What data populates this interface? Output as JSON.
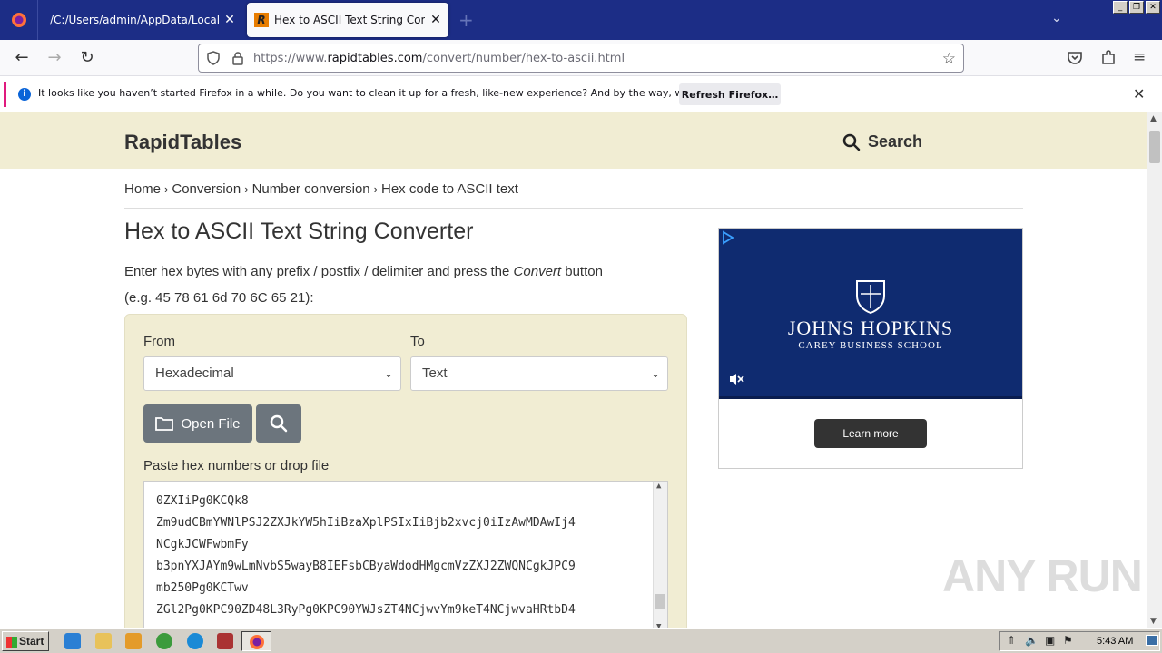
{
  "browser": {
    "tabs": [
      {
        "label": "/C:/Users/admin/AppData/Local/Temp/"
      },
      {
        "label": "Hex to ASCII Text String Converter",
        "active": true
      }
    ],
    "url_prefix": "https://www.",
    "url_domain": "rapidtables.com",
    "url_path": "/convert/number/hex-to-ascii.html"
  },
  "notification": {
    "text": "It looks like you haven’t started Firefox in a while. Do you want to clean it up for a fresh, like-new experience? And by the way, welcome back!",
    "button": "Refresh Firefox…"
  },
  "site": {
    "logo": "RapidTables",
    "search_label": "Search"
  },
  "breadcrumb": [
    "Home",
    "Conversion",
    "Number conversion",
    "Hex code to ASCII text"
  ],
  "page": {
    "title": "Hex to ASCII Text String Converter",
    "intro_a": "Enter hex bytes with any prefix / postfix / delimiter and press the ",
    "intro_em": "Convert",
    "intro_b": " button",
    "example": "(e.g. 45 78 61 6d 70 6C 65 21):"
  },
  "form": {
    "from_label": "From",
    "from_value": "Hexadecimal",
    "to_label": "To",
    "to_value": "Text",
    "open_file": "Open File",
    "paste_label": "Paste hex numbers or drop file",
    "hex_lines": [
      "0ZXIiPg0KCQk8",
      "Zm9udCBmYWNlPSJ2ZXJkYW5hIiBzaXplPSIxIiBjb2xvcj0iIzAwMDAwIj4",
      "NCgkJCWFwbmFy",
      "b3pnYXJAYm9wLmNvbS5wayB8IEFsbCByaWdodHMgcmVzZXJ2ZWQNCgkJPC9",
      "mb250Pg0KCTwv",
      "ZGl2Pg0KPC90ZD48L3RyPg0KPC90YWJsZT4NCjwvYm9keT4NCjwvaHRtbD4"
    ]
  },
  "ad": {
    "brand": "JOHNS HOPKINS",
    "sub": "CAREY BUSINESS SCHOOL",
    "button": "Learn more"
  },
  "watermark": "ANY RUN",
  "taskbar": {
    "start": "Start",
    "clock": "5:43 AM"
  },
  "colors": {
    "tab_bar": "#1c2d86",
    "site_header": "#f1edd3",
    "button_gray": "#6c757d",
    "ad_blue": "#0f2b70"
  }
}
